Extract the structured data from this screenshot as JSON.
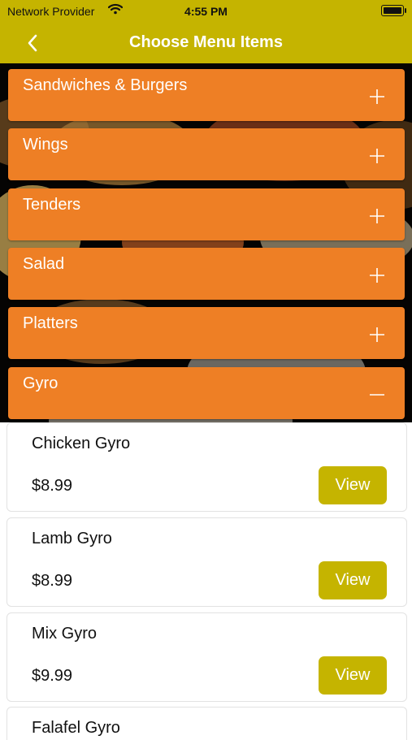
{
  "status_bar": {
    "carrier": "Network Provider",
    "time": "4:55 PM"
  },
  "nav": {
    "title": "Choose Menu Items",
    "back_icon": "chevron-left-icon"
  },
  "colors": {
    "brand": "#c5b400",
    "category": "#ee7f25",
    "card_border": "#e2e2e2"
  },
  "categories": [
    {
      "label": "Sandwiches & Burgers",
      "state": "collapsed",
      "icon": "plus-icon"
    },
    {
      "label": "Wings",
      "state": "collapsed",
      "icon": "plus-icon"
    },
    {
      "label": "Tenders",
      "state": "collapsed",
      "icon": "plus-icon"
    },
    {
      "label": "Salad",
      "state": "collapsed",
      "icon": "plus-icon"
    },
    {
      "label": "Platters",
      "state": "collapsed",
      "icon": "plus-icon"
    },
    {
      "label": "Gyro",
      "state": "expanded",
      "icon": "minus-icon"
    }
  ],
  "items": [
    {
      "name": "Chicken Gyro",
      "price": "$8.99",
      "button": "View"
    },
    {
      "name": "Lamb Gyro",
      "price": "$8.99",
      "button": "View"
    },
    {
      "name": "Mix Gyro",
      "price": "$9.99",
      "button": "View"
    },
    {
      "name": "Falafel Gyro",
      "price": "",
      "button": ""
    }
  ]
}
